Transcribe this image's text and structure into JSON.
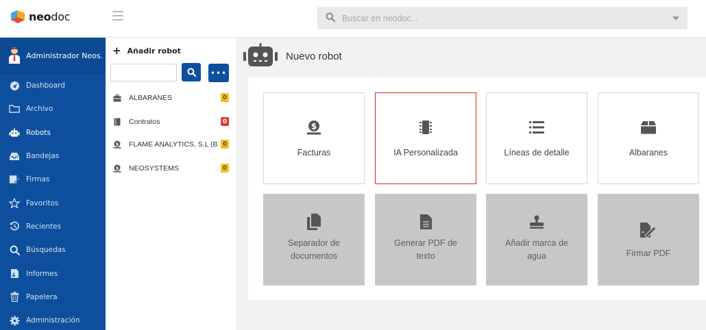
{
  "brand": {
    "logo_bold": "neo",
    "logo_rest": "doc"
  },
  "search": {
    "placeholder": "Buscar en neodoc..."
  },
  "user": {
    "name": "Administrador Neos..."
  },
  "sidebar": {
    "items": [
      {
        "label": "Dashboard",
        "icon": "dashboard-icon"
      },
      {
        "label": "Archivo",
        "icon": "folder-icon"
      },
      {
        "label": "Robots",
        "icon": "robot-icon"
      },
      {
        "label": "Bandejas",
        "icon": "tray-icon"
      },
      {
        "label": "Firmas",
        "icon": "signature-icon"
      },
      {
        "label": "Favoritos",
        "icon": "star-icon"
      },
      {
        "label": "Recientes",
        "icon": "history-icon"
      },
      {
        "label": "Búsquedas",
        "icon": "search-icon"
      },
      {
        "label": "Informes",
        "icon": "report-icon"
      },
      {
        "label": "Papelera",
        "icon": "trash-icon"
      },
      {
        "label": "Administración",
        "icon": "gear-icon"
      }
    ]
  },
  "robot_panel": {
    "add_label": "Añadir robot",
    "more_label": "•••",
    "folders": [
      {
        "label": "ALBARANES",
        "count": "0",
        "badge_color": "#f2c01e",
        "icon": "briefcase-icon"
      },
      {
        "label": "Contratos",
        "count": "0",
        "badge_color": "#e23c3c",
        "icon": "document-icon"
      },
      {
        "label": "FLAME ANALYTICS, S.L (B...",
        "count": "0",
        "badge_color": "#f2c01e",
        "icon": "invoice-icon"
      },
      {
        "label": "NEOSYSTEMS",
        "count": "0",
        "badge_color": "#f2c01e",
        "icon": "invoice-icon"
      }
    ]
  },
  "main": {
    "title": "Nuevo robot",
    "cards": [
      {
        "label": "Facturas",
        "icon": "invoice-icon"
      },
      {
        "label": "IA Personalizada",
        "icon": "chip-icon"
      },
      {
        "label": "Líneas de detalle",
        "icon": "list-icon"
      },
      {
        "label": "Albaranes",
        "icon": "box-icon"
      },
      {
        "label": "Separador de documentos",
        "icon": "copy-icon"
      },
      {
        "label": "Generar PDF de texto",
        "icon": "file-text-icon"
      },
      {
        "label": "Añadir marca de agua",
        "icon": "stamp-icon"
      },
      {
        "label": "Firmar PDF",
        "icon": "sign-file-icon"
      }
    ]
  },
  "colors": {
    "primary": "#0d4f9c",
    "selected_border": "#d32424",
    "disabled_card": "#c7c7c7"
  }
}
